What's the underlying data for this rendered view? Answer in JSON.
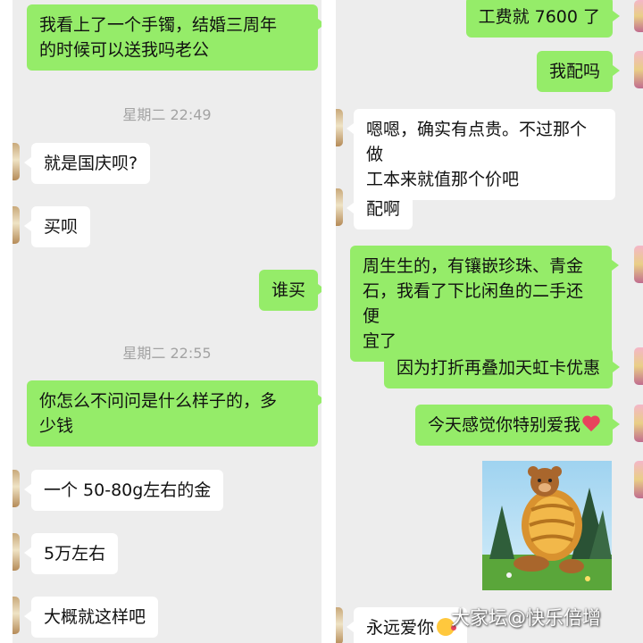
{
  "left_panel": {
    "messages": [
      {
        "side": "out",
        "text": "我看上了一个手镯，结婚三周年\n的时候可以送我吗老公"
      },
      {
        "timestamp": "星期二 22:49"
      },
      {
        "side": "in",
        "text": "就是国庆呗?"
      },
      {
        "side": "in",
        "text": "买呗"
      },
      {
        "side": "out",
        "text": "谁买"
      },
      {
        "timestamp": "星期二 22:55"
      },
      {
        "side": "out",
        "text": "你怎么不问问是什么样子的，多\n少钱"
      },
      {
        "side": "in",
        "text": "一个 50-80g左右的金"
      },
      {
        "side": "in",
        "text": "5万左右"
      },
      {
        "side": "in",
        "text": "大概就这样吧"
      }
    ]
  },
  "right_panel": {
    "messages": [
      {
        "side": "out",
        "text": "工费就 7600 了"
      },
      {
        "side": "out",
        "text": "我配吗"
      },
      {
        "side": "in",
        "text": "嗯嗯，确实有点贵。不过那个做\n工本来就值那个价吧"
      },
      {
        "side": "in",
        "text": "配啊"
      },
      {
        "side": "out",
        "text": "周生生的，有镶嵌珍珠、青金\n石，我看了下比闲鱼的二手还便\n宜了"
      },
      {
        "side": "out",
        "text": "因为打折再叠加天虹卡优惠"
      },
      {
        "side": "out",
        "text": "今天感觉你特别爱我",
        "emoji": "red-heart"
      },
      {
        "side": "out",
        "sticker": "cartoon-bear-sticker"
      },
      {
        "side": "in",
        "text": "永远爱你",
        "emoji": "face-blowing-kiss"
      }
    ]
  },
  "watermark": "大家坛@快乐倍增",
  "colors": {
    "panel_bg": "#ededed",
    "outgoing_bubble": "#95ec69",
    "incoming_bubble": "#ffffff",
    "timestamp_text": "#a3a3a3"
  }
}
